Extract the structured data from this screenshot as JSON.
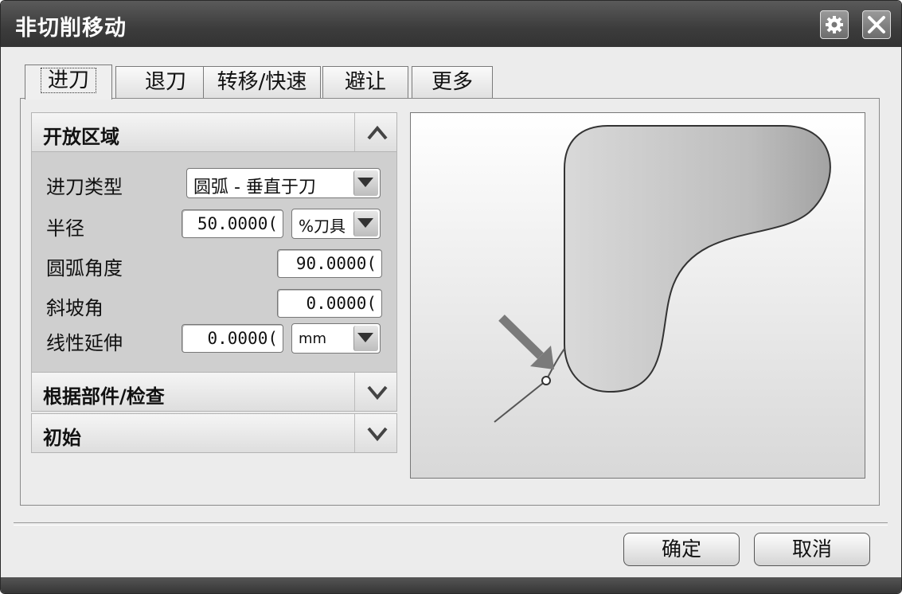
{
  "window": {
    "title": "非切削移动"
  },
  "tabs": [
    {
      "label": "进刀",
      "active": true
    },
    {
      "label": "退刀"
    },
    {
      "label": "转移/快速"
    },
    {
      "label": "避让"
    },
    {
      "label": "更多"
    }
  ],
  "groups": {
    "open_area": {
      "title": "开放区域",
      "state": "expanded"
    },
    "by_part": {
      "title": "根据部件/检查",
      "state": "collapsed"
    },
    "initial": {
      "title": "初始",
      "state": "collapsed"
    }
  },
  "fields": {
    "entry_type": {
      "label": "进刀类型",
      "value": "圆弧 - 垂直于刀"
    },
    "radius": {
      "label": "半径",
      "value": "50.0000(",
      "unit": "%刀具"
    },
    "arc_angle": {
      "label": "圆弧角度",
      "value": "90.0000("
    },
    "ramp_angle": {
      "label": "斜坡角",
      "value": "0.0000("
    },
    "linear_extension": {
      "label": "线性延伸",
      "value": "0.0000(",
      "unit": "mm"
    }
  },
  "buttons": {
    "ok": "确定",
    "cancel": "取消"
  },
  "icons": [
    "gear-icon",
    "close-icon",
    "chevron-up-icon",
    "chevron-down-icon",
    "dropdown-arrow-icon",
    "direction-arrow-icon"
  ]
}
